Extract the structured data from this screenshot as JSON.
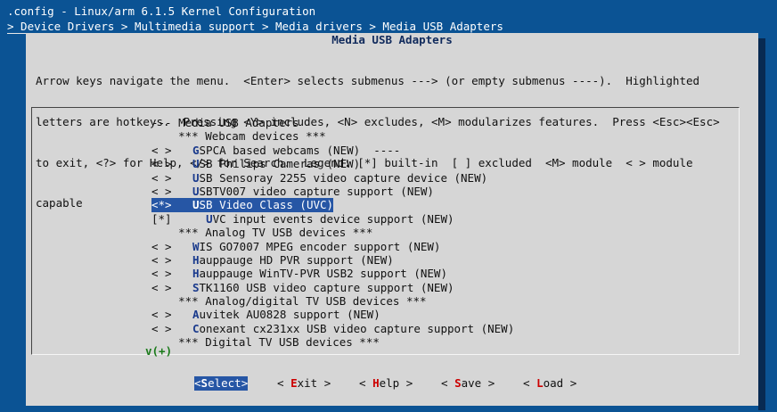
{
  "header": {
    "title": ".config - Linux/arm 6.1.5 Kernel Configuration",
    "breadcrumb": "> Device Drivers > Multimedia support > Media drivers > Media USB Adapters"
  },
  "dialog": {
    "title": "Media USB Adapters",
    "help_lines": [
      "Arrow keys navigate the menu.  <Enter> selects submenus ---> (or empty submenus ----).  Highlighted",
      "letters are hotkeys.  Pressing <Y> includes, <N> excludes, <M> modularizes features.  Press <Esc><Esc>",
      "to exit, <?> for Help, </> for Search.  Legend: [*] built-in  [ ] excluded  <M> module  < > module",
      "capable"
    ]
  },
  "menu": {
    "items": [
      {
        "sym": "",
        "pre": "--- Media USB Adapters",
        "hk": "",
        "rest": ""
      },
      {
        "sym": "",
        "pre": "    *** Webcam devices ***",
        "hk": "",
        "rest": ""
      },
      {
        "sym": "< >",
        "pre": "    ",
        "hk": "G",
        "rest": "SPCA based webcams (NEW)  ----"
      },
      {
        "sym": "< >",
        "pre": "    ",
        "hk": "U",
        "rest": "SB Philips Cameras (NEW)"
      },
      {
        "sym": "< >",
        "pre": "    ",
        "hk": "U",
        "rest": "SB Sensoray 2255 video capture device (NEW)"
      },
      {
        "sym": "< >",
        "pre": "    ",
        "hk": "U",
        "rest": "SBTV007 video capture support (NEW)"
      },
      {
        "sym": "<*>",
        "pre": "    ",
        "hk": "U",
        "rest": "SB Video Class (UVC)",
        "selected": true
      },
      {
        "sym": "[*]",
        "pre": "      ",
        "hk": "U",
        "rest": "VC input events device support (NEW)"
      },
      {
        "sym": "",
        "pre": "    *** Analog TV USB devices ***",
        "hk": "",
        "rest": ""
      },
      {
        "sym": "< >",
        "pre": "    ",
        "hk": "W",
        "rest": "IS GO7007 MPEG encoder support (NEW)"
      },
      {
        "sym": "< >",
        "pre": "    ",
        "hk": "H",
        "rest": "auppauge HD PVR support (NEW)"
      },
      {
        "sym": "< >",
        "pre": "    ",
        "hk": "H",
        "rest": "auppauge WinTV-PVR USB2 support (NEW)"
      },
      {
        "sym": "< >",
        "pre": "    ",
        "hk": "S",
        "rest": "TK1160 USB video capture support (NEW)"
      },
      {
        "sym": "",
        "pre": "    *** Analog/digital TV USB devices ***",
        "hk": "",
        "rest": ""
      },
      {
        "sym": "< >",
        "pre": "    ",
        "hk": "A",
        "rest": "uvitek AU0828 support (NEW)"
      },
      {
        "sym": "< >",
        "pre": "    ",
        "hk": "C",
        "rest": "onexant cx231xx USB video capture support (NEW)"
      },
      {
        "sym": "",
        "pre": "    *** Digital TV USB devices ***",
        "hk": "",
        "rest": ""
      }
    ],
    "more_indicator": "v(+)"
  },
  "buttons": [
    {
      "pre": "<",
      "hk": "S",
      "rest": "elect>",
      "active": true
    },
    {
      "pre": "< ",
      "hk": "E",
      "rest": "xit >",
      "active": false
    },
    {
      "pre": "< ",
      "hk": "H",
      "rest": "elp >",
      "active": false
    },
    {
      "pre": "< ",
      "hk": "S",
      "rest": "ave >",
      "active": false
    },
    {
      "pre": "< ",
      "hk": "L",
      "rest": "oad >",
      "active": false
    }
  ],
  "colors": {
    "background": "#0b5394",
    "dialog": "#d6d6d6",
    "selection": "#2656a5",
    "hotkey_menu": "#1a3a8c",
    "hotkey_button": "#cc0000",
    "more_indicator": "#1a7a1a"
  }
}
